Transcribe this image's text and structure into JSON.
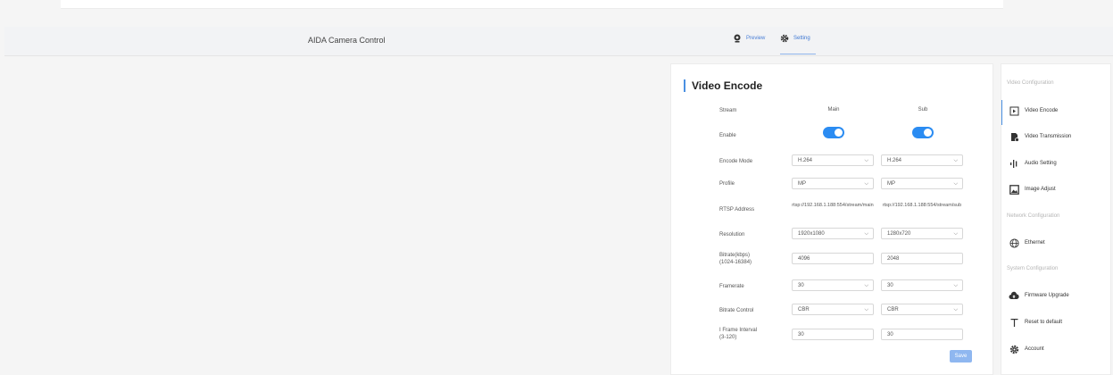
{
  "header": {
    "app_title": "AIDA Camera Control",
    "nav": [
      {
        "label": "Preview",
        "icon": "webcam-icon"
      },
      {
        "label": "Setting",
        "icon": "gear-icon",
        "active": true
      }
    ]
  },
  "encode": {
    "title": "Video Encode",
    "columns": {
      "stream_label": "Stream",
      "main": "Main",
      "sub": "Sub"
    },
    "rows": {
      "enable": {
        "label": "Enable",
        "main": true,
        "sub": true
      },
      "encode_mode": {
        "label": "Encode Mode",
        "main": "H.264",
        "sub": "H.264"
      },
      "profile": {
        "label": "Profile",
        "main": "MP",
        "sub": "MP"
      },
      "rtsp": {
        "label": "RTSP Address",
        "main": "rtsp://192.168.1.188:554/stream/main",
        "sub": "rtsp://192.168.1.188:554/stream/sub"
      },
      "resolution": {
        "label": "Resolution",
        "main": "1920x1080",
        "sub": "1280x720"
      },
      "bitrate": {
        "label_line1": "Bitrate(kbps)",
        "label_line2": "(1024-16384)",
        "main": "4096",
        "sub": "2048"
      },
      "framerate": {
        "label": "Framerate",
        "main": "30",
        "sub": "30"
      },
      "bitrate_control": {
        "label": "Bitrate Control",
        "main": "CBR",
        "sub": "CBR"
      },
      "iframe": {
        "label_line1": "I Frame Interval",
        "label_line2": "(3-120)",
        "main": "30",
        "sub": "30"
      }
    },
    "save_label": "Save",
    "accent": "#2b8cf2"
  },
  "sidebar": {
    "sections": {
      "video": "Video Configuration",
      "network": "Network Configuration",
      "system": "System Configuration"
    },
    "items": [
      {
        "label": "Video Encode",
        "icon": "video-encode-icon",
        "active": true
      },
      {
        "label": "Video Transmission",
        "icon": "video-transmission-icon"
      },
      {
        "label": "Audio Setting",
        "icon": "audio-bars-icon"
      },
      {
        "label": "Image Adjust",
        "icon": "image-icon"
      },
      {
        "label": "Ethernet",
        "icon": "globe-icon"
      },
      {
        "label": "Firmware Upgrade",
        "icon": "cloud-upload-icon"
      },
      {
        "label": "Reset to default",
        "icon": "reset-t-icon"
      },
      {
        "label": "Account",
        "icon": "gear-icon"
      }
    ]
  }
}
